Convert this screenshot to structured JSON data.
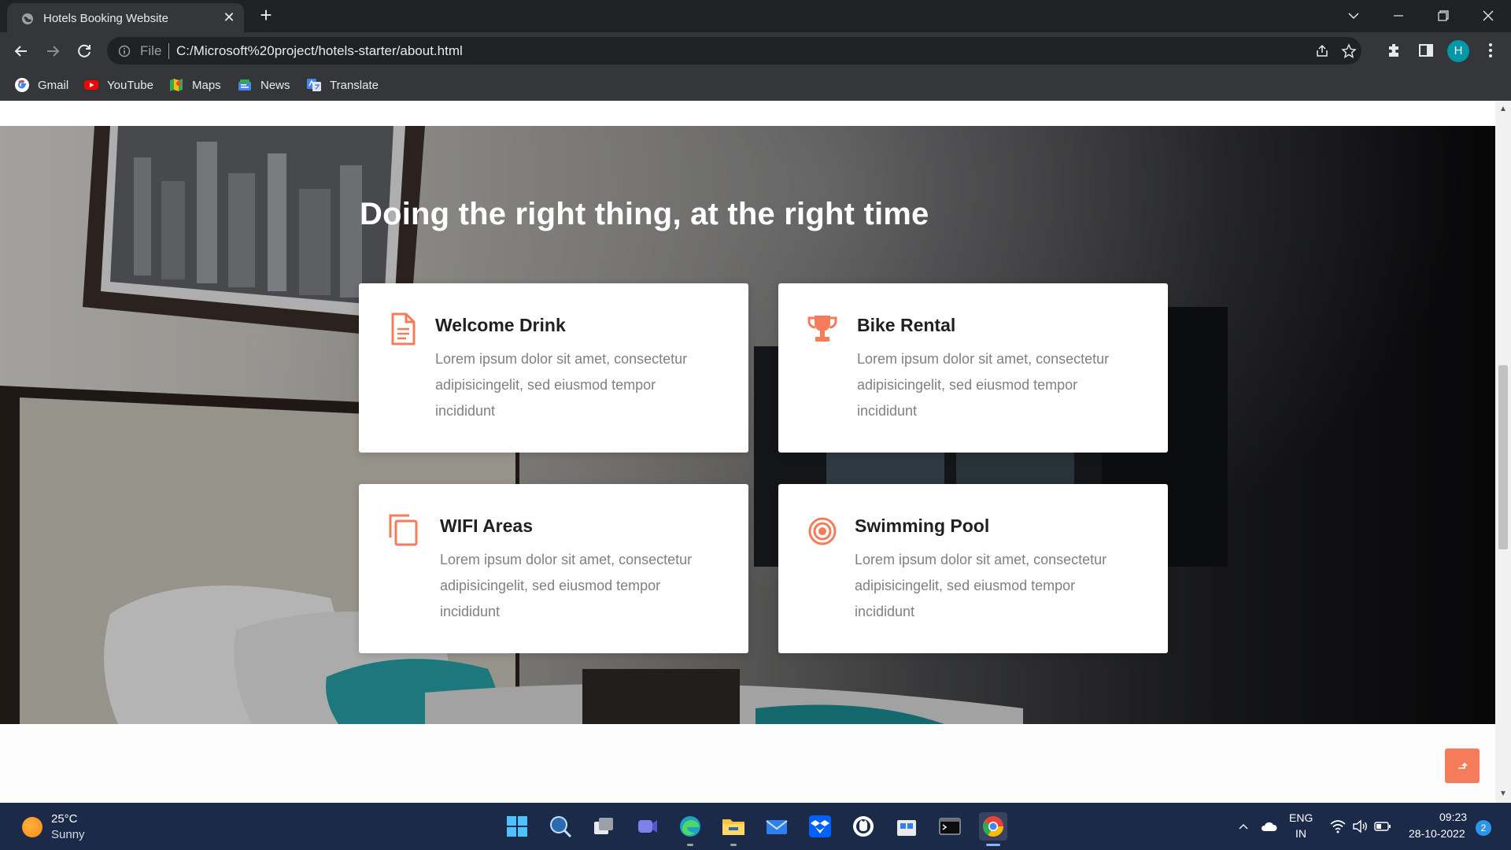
{
  "browser": {
    "tab_title": "Hotels Booking Website",
    "tab_close": "✕",
    "new_tab": "+",
    "address_scheme_label": "File",
    "address_url": "C:/Microsoft%20project/hotels-starter/about.html",
    "profile_initial": "H",
    "bookmarks": [
      {
        "label": "Gmail",
        "icon": "gmail-icon"
      },
      {
        "label": "YouTube",
        "icon": "youtube-icon"
      },
      {
        "label": "Maps",
        "icon": "maps-icon"
      },
      {
        "label": "News",
        "icon": "news-icon"
      },
      {
        "label": "Translate",
        "icon": "translate-icon"
      }
    ]
  },
  "page": {
    "section_title": "Doing the right thing, at the right time",
    "accent_color": "#f47c5a",
    "cards": [
      {
        "title": "Welcome Drink",
        "icon": "document-icon",
        "text": "Lorem ipsum dolor sit amet, consectetur adipisicingelit, sed eiusmod tempor incididunt"
      },
      {
        "title": "Bike Rental",
        "icon": "trophy-icon",
        "text": "Lorem ipsum dolor sit amet, consectetur adipisicingelit, sed eiusmod tempor incididunt"
      },
      {
        "title": "WIFI Areas",
        "icon": "copy-icon",
        "text": "Lorem ipsum dolor sit amet, consectetur adipisicingelit, sed eiusmod tempor incididunt"
      },
      {
        "title": "Swimming Pool",
        "icon": "target-icon",
        "text": "Lorem ipsum dolor sit amet, consectetur adipisicingelit, sed eiusmod tempor incididunt"
      }
    ],
    "back_to_top_icon": "arrow-up-icon"
  },
  "taskbar": {
    "weather_temp": "25°C",
    "weather_desc": "Sunny",
    "apps": [
      "start-icon",
      "search-icon",
      "task-view-icon",
      "teams-icon",
      "edge-icon",
      "file-explorer-icon",
      "mail-icon",
      "dropbox-icon",
      "github-icon",
      "store-icon",
      "terminal-icon",
      "chrome-icon"
    ],
    "lang_line1": "ENG",
    "lang_line2": "IN",
    "time": "09:23",
    "date": "28-10-2022",
    "notification_count": "2"
  }
}
